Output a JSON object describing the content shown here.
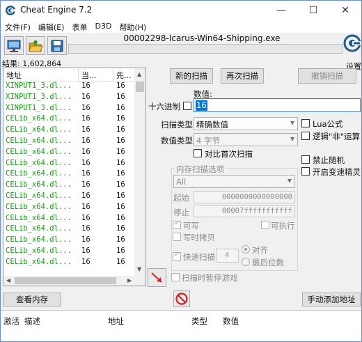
{
  "window": {
    "title": "Cheat Engine 7.2",
    "controls": [
      "—",
      "☐",
      "✕"
    ]
  },
  "menu": [
    "文件(F)",
    "编辑(E)",
    "表单",
    "D3D",
    "帮助(H)"
  ],
  "toolbar": {
    "process_name": "00002298-Icarus-Win64-Shipping.exe",
    "settings_label": "设置",
    "progress": 0
  },
  "results": {
    "count_label": "结果: 1,602,864",
    "columns": [
      "地址",
      "当...",
      "先..."
    ],
    "rows": [
      {
        "address": "XINPUT1_3.dl...",
        "value": "16",
        "previous": "16"
      },
      {
        "address": "XINPUT1_3.dl...",
        "value": "16",
        "previous": "16"
      },
      {
        "address": "XINPUT1_3.dl...",
        "value": "16",
        "previous": "16"
      },
      {
        "address": "CELib_x64.dl...",
        "value": "16",
        "previous": "16"
      },
      {
        "address": "CELib_x64.dl...",
        "value": "16",
        "previous": "16"
      },
      {
        "address": "CELib_x64.dl...",
        "value": "16",
        "previous": "16"
      },
      {
        "address": "CELib_x64.dl...",
        "value": "16",
        "previous": "16"
      },
      {
        "address": "CELib_x64.dl...",
        "value": "16",
        "previous": "16"
      },
      {
        "address": "CELib_x64.dl...",
        "value": "16",
        "previous": "16"
      },
      {
        "address": "CELib_x64.dl...",
        "value": "16",
        "previous": "16"
      },
      {
        "address": "CELib_x64.dl...",
        "value": "16",
        "previous": "16"
      },
      {
        "address": "CELib_x64.dl...",
        "value": "16",
        "previous": "16"
      },
      {
        "address": "CELib_x64.dl...",
        "value": "16",
        "previous": "16"
      },
      {
        "address": "CELib_x64.dl...",
        "value": "16",
        "previous": "16"
      },
      {
        "address": "CELib_x64.dl...",
        "value": "16",
        "previous": "16"
      },
      {
        "address": "CELib_x64.dl...",
        "value": "16",
        "previous": "16"
      },
      {
        "address": "CELib_x64.dl...",
        "value": "16",
        "previous": "16"
      }
    ]
  },
  "scan_buttons": {
    "new_scan": "新的扫描",
    "next_scan": "再次扫描",
    "undo_scan": "撤销扫描"
  },
  "value": {
    "label": "数值:",
    "hex_label": "十六进制",
    "input": "16"
  },
  "scan_type": {
    "label": "扫描类型",
    "selected": "精确数值"
  },
  "value_type": {
    "label": "数值类型",
    "selected": "4 字节"
  },
  "compare_first": "对比首次扫描",
  "memory_options": {
    "title": "内存扫描选项",
    "region": "All",
    "start_label": "起始",
    "start_value": "0000000000000000",
    "stop_label": "停止",
    "stop_value": "00007fffffffffff",
    "writable": "可写",
    "executable": "可执行",
    "copy_on_write": "写时拷贝",
    "fast_scan": "快速扫描",
    "fast_scan_value": "4",
    "align": "对齐",
    "last_digits": "最后位数",
    "pause_game": "扫描时暂停游戏"
  },
  "right_options": {
    "lua": "Lua公式",
    "not_logic": "逻辑\"非\"运算",
    "no_random": "禁止随机",
    "speedhack": "开启变速精灵"
  },
  "bottom": {
    "view_memory": "查看内存",
    "add_address": "手动添加地址",
    "columns": [
      "激活",
      "描述",
      "地址",
      "类型",
      "数值"
    ]
  }
}
